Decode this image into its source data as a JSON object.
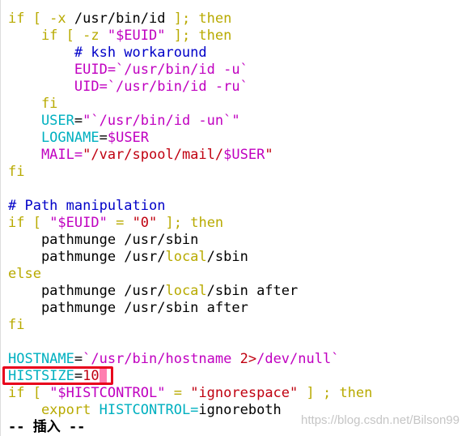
{
  "editor": {
    "lines": [
      [
        [
          "if [ -x ",
          "kw"
        ],
        [
          "/usr/bin/id ",
          "n"
        ],
        [
          "]; then",
          "kw"
        ]
      ],
      [
        [
          "    if [ -z ",
          "kw"
        ],
        [
          "\"$EUID\"",
          "var"
        ],
        [
          " ]; then",
          "kw"
        ]
      ],
      [
        [
          "        # ksh workaround",
          "cm"
        ]
      ],
      [
        [
          "        EUID=`/usr/bin/id -u`",
          "var"
        ]
      ],
      [
        [
          "        UID=`/usr/bin/id -ru`",
          "var"
        ]
      ],
      [
        [
          "    fi",
          "kw"
        ]
      ],
      [
        [
          "    USER",
          "id"
        ],
        [
          "=",
          "n"
        ],
        [
          "\"`/usr/bin/id -un`\"",
          "var"
        ]
      ],
      [
        [
          "    LOGNAME",
          "id"
        ],
        [
          "=",
          "n"
        ],
        [
          "$USER",
          "var"
        ]
      ],
      [
        [
          "    MAIL=",
          "var"
        ],
        [
          "\"/var/spool/mail/",
          "str"
        ],
        [
          "$USER",
          "var"
        ],
        [
          "\"",
          "str"
        ]
      ],
      [
        [
          "fi",
          "kw"
        ]
      ],
      [],
      [
        [
          "# Path manipulation",
          "cm"
        ]
      ],
      [
        [
          "if [ ",
          "kw"
        ],
        [
          "\"$EUID\"",
          "var"
        ],
        [
          " = ",
          "kw"
        ],
        [
          "\"0\"",
          "str"
        ],
        [
          " ]; then",
          "kw"
        ]
      ],
      [
        [
          "    pathmunge /usr/sbin",
          "n"
        ]
      ],
      [
        [
          "    pathmunge /usr/",
          "n"
        ],
        [
          "local",
          "kw"
        ],
        [
          "/sbin",
          "n"
        ]
      ],
      [
        [
          "else",
          "kw"
        ]
      ],
      [
        [
          "    pathmunge /usr/",
          "n"
        ],
        [
          "local",
          "kw"
        ],
        [
          "/sbin after",
          "n"
        ]
      ],
      [
        [
          "    pathmunge /usr/sbin after",
          "n"
        ]
      ],
      [
        [
          "fi",
          "kw"
        ]
      ],
      [],
      [
        [
          "HOSTNAME",
          "id"
        ],
        [
          "=",
          "n"
        ],
        [
          "`/usr/bin/hostname ",
          "var"
        ],
        [
          "2>",
          "str"
        ],
        [
          "/dev/null`",
          "var"
        ]
      ],
      [
        [
          "HISTSIZE",
          "id"
        ],
        [
          "=",
          "n"
        ],
        [
          "10",
          "str"
        ]
      ],
      [
        [
          "if [ ",
          "kw"
        ],
        [
          "\"$HISTCONTROL\"",
          "var"
        ],
        [
          " = ",
          "kw"
        ],
        [
          "\"ignorespace\"",
          "str"
        ],
        [
          " ] ; then",
          "kw"
        ]
      ],
      [
        [
          "    export ",
          "kw"
        ],
        [
          "HISTCONTROL=",
          "id"
        ],
        [
          "ignoreboth",
          "n"
        ]
      ]
    ],
    "cursor_line": 21,
    "mode_text": "-- 插入 --"
  },
  "watermark": "https://blog.csdn.net/Bilson99",
  "colors": {
    "keyword": "#b8aa00",
    "variable": "#c000c0",
    "identifier": "#00b0c0",
    "string": "#c00010",
    "comment": "#0000c8",
    "cursor": "#ff7fb0",
    "highlight_box": "#e8001c"
  }
}
